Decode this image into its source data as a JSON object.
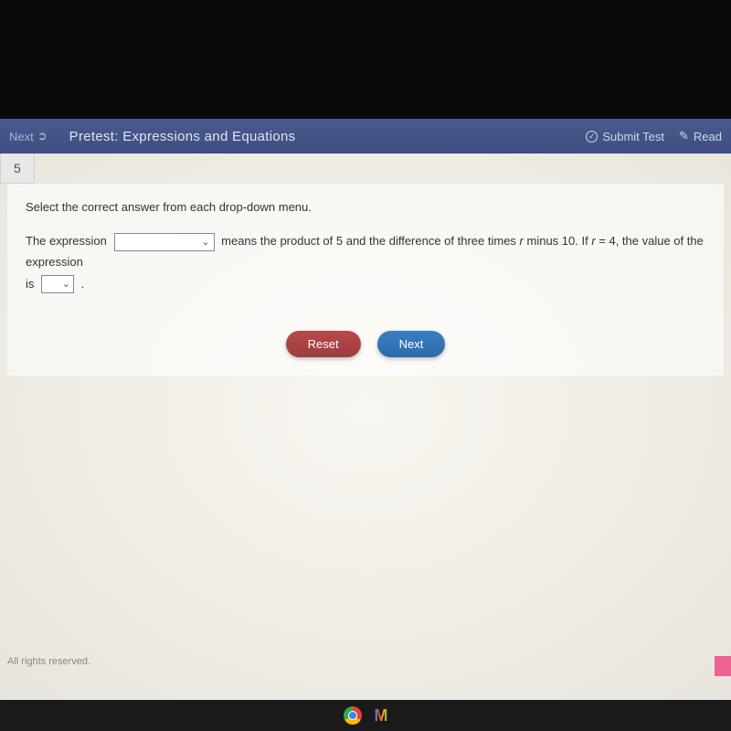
{
  "header": {
    "nextLabel": "Next",
    "title": "Pretest: Expressions and Equations",
    "submitLabel": "Submit Test",
    "readerLabel": "Read"
  },
  "question": {
    "number": "5",
    "instruction": "Select the correct answer from each drop-down menu.",
    "text1": "The expression",
    "text2": "means the product of 5 and the difference of three times ",
    "textR": "r",
    "text3": " minus 10. If ",
    "textR2": "r",
    "text4": " = 4, the value of the expression",
    "text5": "is",
    "text6": "."
  },
  "buttons": {
    "reset": "Reset",
    "next": "Next"
  },
  "footer": {
    "rights": "All rights reserved."
  }
}
